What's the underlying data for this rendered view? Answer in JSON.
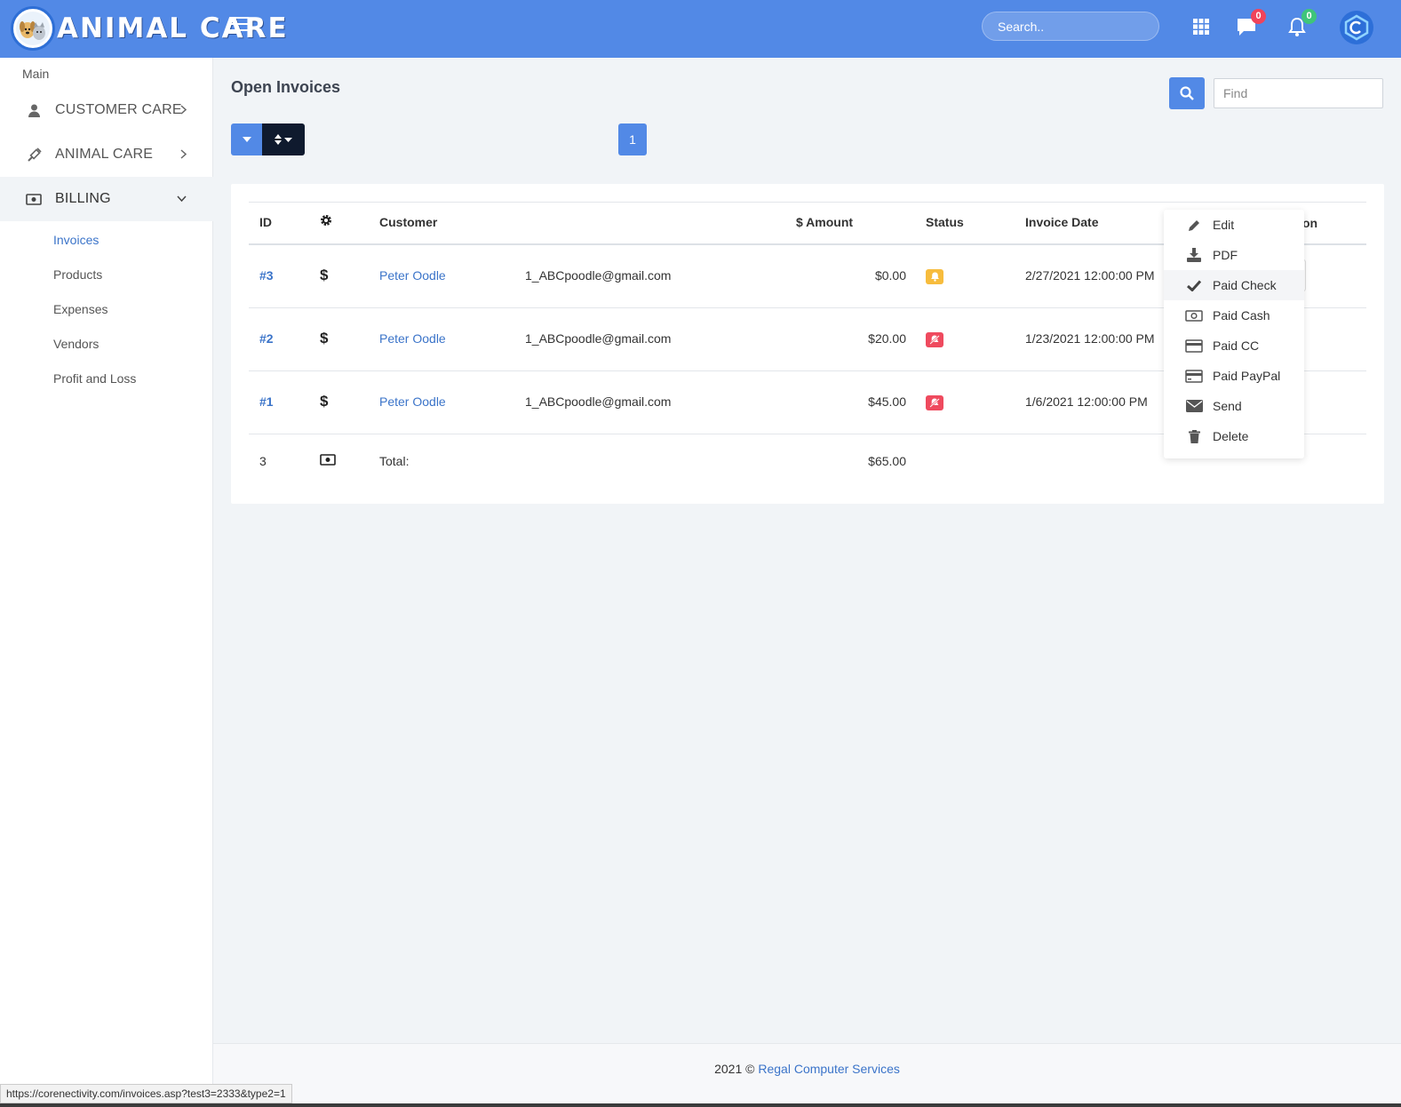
{
  "colors": {
    "primary": "#5289e6",
    "dark_button": "#0f1a2e",
    "link": "#3b74c9",
    "warning": "#f7bc3d",
    "danger": "#ef4a5e",
    "badge_red": "#f0435b",
    "badge_green": "#3fc57a"
  },
  "header": {
    "logo_text": "ANIMAL CARE",
    "search_placeholder": "Search..",
    "icons": [
      "menu-icon",
      "search-icon",
      "apps-grid-icon",
      "chat-icon",
      "bell-icon",
      "profile-logo-icon"
    ],
    "messages_count": "0",
    "notifications_count": "0"
  },
  "sidebar": {
    "section_label": "Main",
    "items": [
      {
        "label": "CUSTOMER CARE",
        "icon": "user-icon"
      },
      {
        "label": "ANIMAL CARE",
        "icon": "syringe-icon"
      },
      {
        "label": "BILLING",
        "icon": "money-icon"
      }
    ],
    "billing_sub": [
      "Invoices",
      "Products",
      "Expenses",
      "Vendors",
      "Profit and Loss"
    ]
  },
  "main": {
    "title": "Open Invoices",
    "find_placeholder": "Find",
    "current_page": "1",
    "table": {
      "columns": [
        "ID",
        "",
        "Customer",
        "$ Amount",
        "Status",
        "Invoice Date"
      ],
      "peek_column_suffix": "on",
      "rows": [
        {
          "id": "#3",
          "symbol": "$",
          "customer": "Peter Oodle",
          "email": "1_ABCpoodle@gmail.com",
          "amount": "$0.00",
          "status": "bell-icon",
          "date": "2/27/2021 12:00:00 PM"
        },
        {
          "id": "#2",
          "symbol": "$",
          "customer": "Peter Oodle",
          "email": "1_ABCpoodle@gmail.com",
          "amount": "$20.00",
          "status": "bell-slash-icon",
          "date": "1/23/2021 12:00:00 PM"
        },
        {
          "id": "#1",
          "symbol": "$",
          "customer": "Peter Oodle",
          "email": "1_ABCpoodle@gmail.com",
          "amount": "$45.00",
          "status": "bell-slash-icon",
          "date": "1/6/2021 12:00:00 PM"
        }
      ],
      "total": {
        "count": "3",
        "label": "Total:",
        "amount": "$65.00"
      }
    },
    "action_menu": [
      {
        "label": "Edit",
        "icon": "pencil-icon"
      },
      {
        "label": "PDF",
        "icon": "download-icon"
      },
      {
        "label": "Paid Check",
        "icon": "check-icon"
      },
      {
        "label": "Paid Cash",
        "icon": "money-icon"
      },
      {
        "label": "Paid CC",
        "icon": "credit-card-icon"
      },
      {
        "label": "Paid PayPal",
        "icon": "credit-card-icon"
      },
      {
        "label": "Send",
        "icon": "envelope-icon"
      },
      {
        "label": "Delete",
        "icon": "trash-icon"
      }
    ]
  },
  "footer": {
    "year_text": "2021 ©",
    "company": "Regal Computer Services"
  },
  "status_url": "https://corenectivity.com/invoices.asp?test3=2333&type2=1"
}
